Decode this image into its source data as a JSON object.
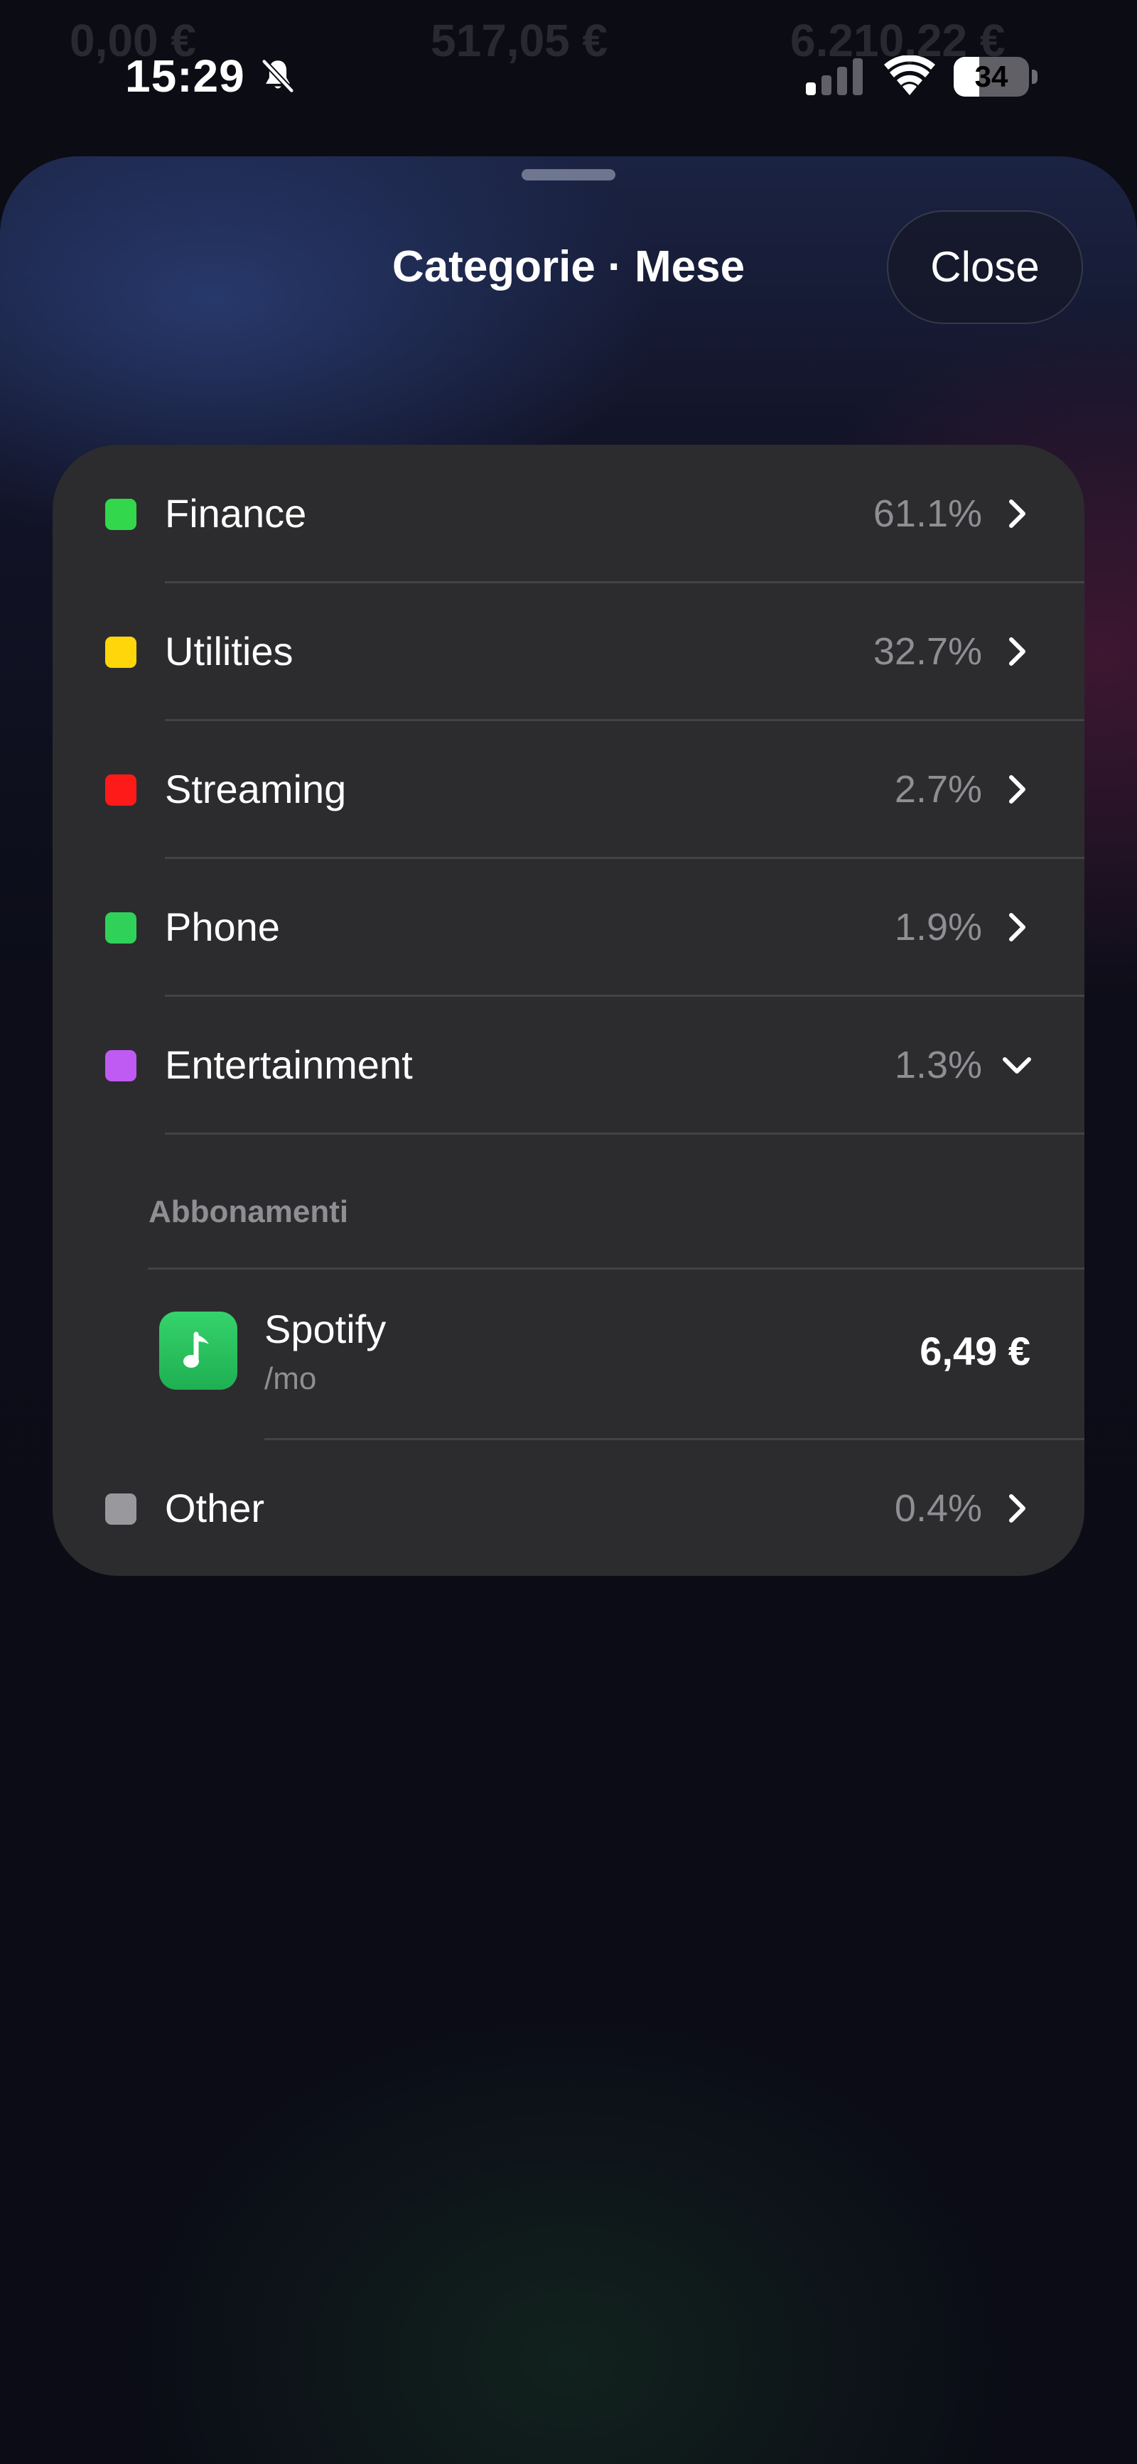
{
  "background_amounts": [
    "0,00 €",
    "517,05 €",
    "6.210,22 €"
  ],
  "status_bar": {
    "time": "15:29",
    "battery_level": "34",
    "battery_fraction": 0.34,
    "icons": [
      "bell-slash-icon",
      "cellular-signal-icon",
      "wifi-icon",
      "battery-icon"
    ]
  },
  "sheet": {
    "title": "Categorie · Mese",
    "close_label": "Close"
  },
  "categories": [
    {
      "label": "Finance",
      "percent": "61.1%",
      "color": "#32d74b",
      "expanded": false
    },
    {
      "label": "Utilities",
      "percent": "32.7%",
      "color": "#ffd60a",
      "expanded": false
    },
    {
      "label": "Streaming",
      "percent": "2.7%",
      "color": "#ff1a1a",
      "expanded": false
    },
    {
      "label": "Phone",
      "percent": "1.9%",
      "color": "#30d158",
      "expanded": false
    },
    {
      "label": "Entertainment",
      "percent": "1.3%",
      "color": "#bf5af2",
      "expanded": true
    },
    {
      "label": "Other",
      "percent": "0.4%",
      "color": "#98989d",
      "expanded": false
    }
  ],
  "entertainment_details": {
    "section_header": "Abbonamenti",
    "subscriptions": [
      {
        "name": "Spotify",
        "period": "/mo",
        "price": "6,49 €",
        "icon": "music-note-icon",
        "icon_color": "#2bc35f"
      }
    ]
  },
  "colors": {
    "card_background": "#2c2c2e",
    "secondary_text": "#8e8e93",
    "separator": "#434347"
  }
}
